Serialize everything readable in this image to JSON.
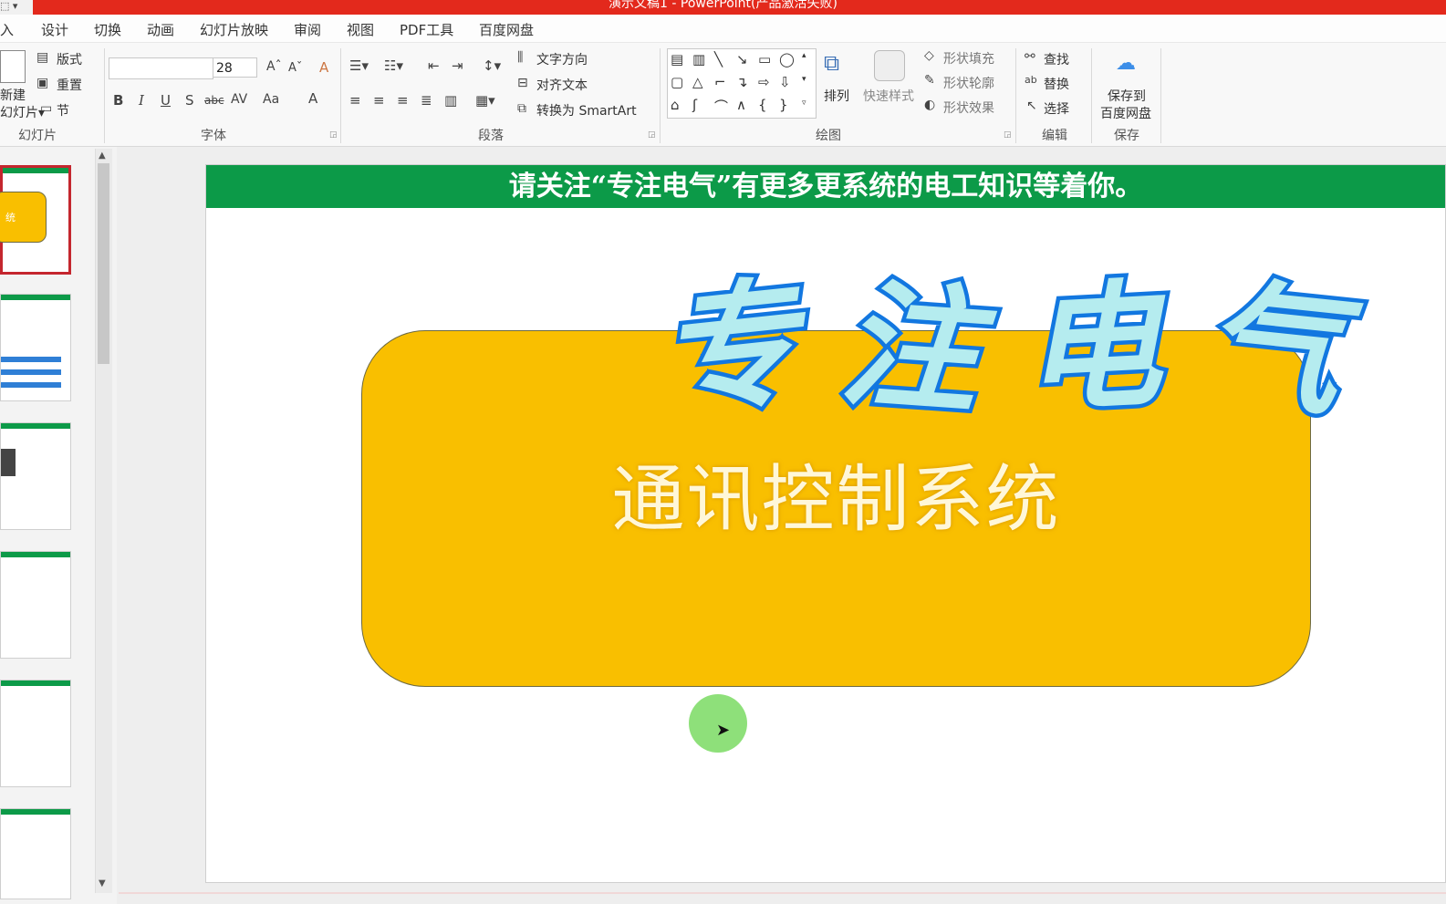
{
  "window": {
    "title": "演示文稿1 - PowerPoint(产品激活失败)",
    "qa_glyph": "⬚ ▾"
  },
  "tabs": [
    "入",
    "设计",
    "切换",
    "动画",
    "幻灯片放映",
    "审阅",
    "视图",
    "PDF工具",
    "百度网盘"
  ],
  "ribbon": {
    "slides_group": {
      "label": "幻灯片",
      "new_slide_line1": "新建",
      "new_slide_line2": "幻灯片▾",
      "layout": "版式",
      "reset": "重置",
      "section": "节"
    },
    "font_group": {
      "label": "字体",
      "font_size": "28",
      "bold": "B",
      "italic": "I",
      "underline": "U",
      "shadow": "S",
      "strike": "abc",
      "spacing": "AV",
      "case": "Aa",
      "color": "A",
      "grow": "Aˆ",
      "shrink": "Aˇ",
      "clear": "A"
    },
    "para_group": {
      "label": "段落",
      "text_direction": "文字方向",
      "align_text": "对齐文本",
      "to_smartart": "转换为 SmartArt"
    },
    "drawing_group": {
      "label": "绘图",
      "arrange": "排列",
      "quick_styles": "快速样式",
      "shape_fill": "形状填充",
      "shape_outline": "形状轮廓",
      "shape_effects": "形状效果"
    },
    "edit_group": {
      "label": "编辑",
      "find": "查找",
      "replace": "替换",
      "select": "选择"
    },
    "save_group": {
      "label": "保存",
      "save_line1": "保存到",
      "save_line2": "百度网盘"
    }
  },
  "thumbnails": [
    {
      "index": 1,
      "selected": true,
      "label": "统"
    },
    {
      "index": 2,
      "selected": false
    },
    {
      "index": 3,
      "selected": false
    },
    {
      "index": 4,
      "selected": false
    },
    {
      "index": 5,
      "selected": false
    },
    {
      "index": 6,
      "selected": false
    }
  ],
  "slide": {
    "banner": "请关注“专注电气”有更多更系统的电工知识等着你。",
    "logo_chars": [
      "专",
      "注",
      "电",
      "气"
    ],
    "subtitle": "通讯控制系统"
  },
  "colors": {
    "title_bar": "#e3291c",
    "banner": "#0c9a48",
    "card": "#f9bf00",
    "logo_fill": "#b5ecef",
    "logo_stroke": "#1277e0",
    "cursor_highlight": "#8ee07a"
  }
}
